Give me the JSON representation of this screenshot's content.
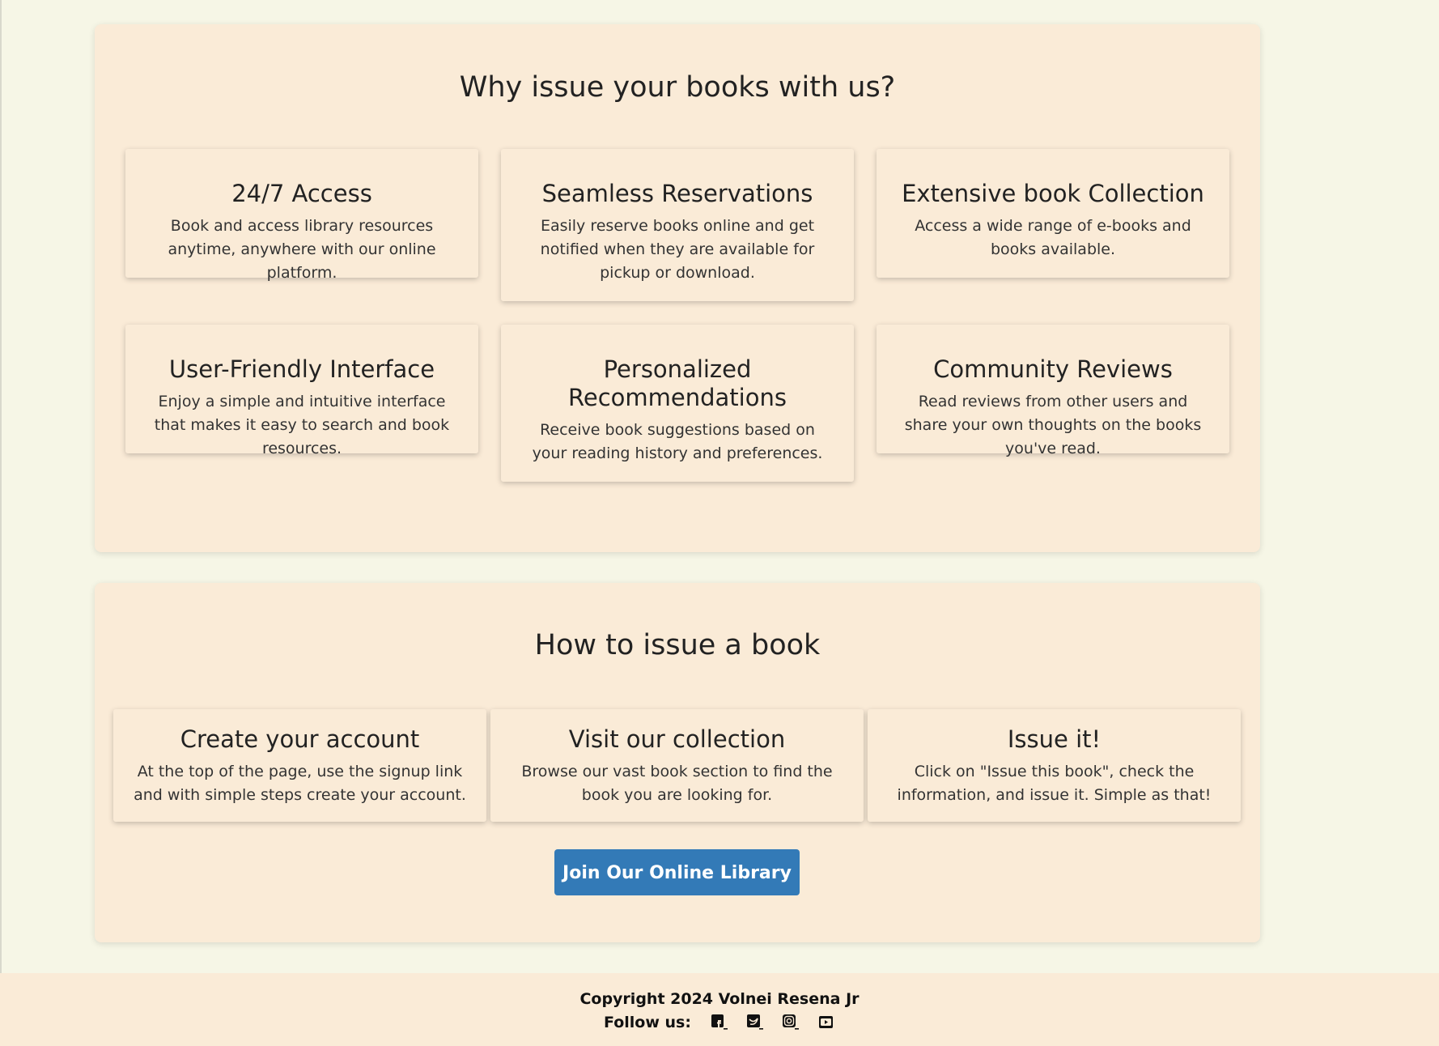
{
  "why": {
    "title": "Why issue your books with us?",
    "features": [
      {
        "title": "24/7 Access",
        "text": "Book and access library resources anytime, anywhere with our online platform."
      },
      {
        "title": "Seamless Reservations",
        "text": "Easily reserve books online and get notified when they are available for pickup or download."
      },
      {
        "title": "Extensive book Collection",
        "text": "Access a wide range of e-books and books available."
      },
      {
        "title": "User-Friendly Interface",
        "text": "Enjoy a simple and intuitive interface that makes it easy to search and book resources."
      },
      {
        "title": "Personalized Recommendations",
        "text": "Receive book suggestions based on your reading history and preferences."
      },
      {
        "title": "Community Reviews",
        "text": "Read reviews from other users and share your own thoughts on the books you've read."
      }
    ]
  },
  "how": {
    "title": "How to issue a book",
    "steps": [
      {
        "title": "Create your account",
        "text": "At the top of the page, use the signup link and with simple steps create your account."
      },
      {
        "title": "Visit our collection",
        "text": "Browse our vast book section to find the book you are looking for."
      },
      {
        "title": "Issue it!",
        "text": "Click on \"Issue this book\", check the information, and issue it. Simple as that!"
      }
    ],
    "join_button": "Join Our Online Library"
  },
  "footer": {
    "copyright": "Copyright 2024 Volnei Resena Jr",
    "follow_label": "Follow us:",
    "social_icons": [
      "facebook-icon",
      "twitter-icon",
      "instagram-icon",
      "youtube-icon"
    ]
  },
  "colors": {
    "page_background": "#f6f6e6",
    "section_background": "#faebd7",
    "button": "#337ab7",
    "text": "#222222"
  }
}
